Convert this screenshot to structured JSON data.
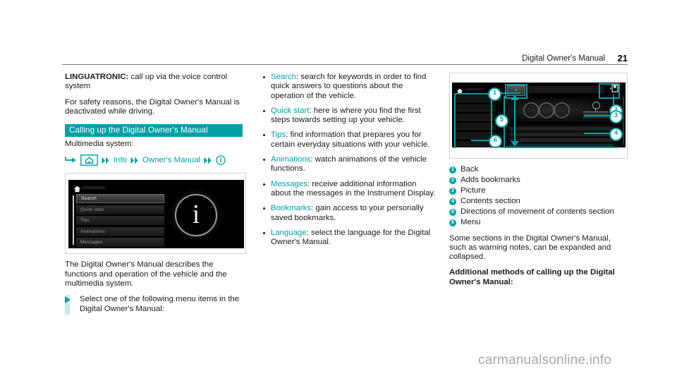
{
  "header": {
    "title": "Digital Owner's Manual",
    "page_number": "21"
  },
  "left_column": {
    "intro_bold": "LINGUATRONIC:",
    "intro_rest": " call up via the voice control system",
    "safety_note": "For safety reasons, the Digital Owner's Manual is deactivated while driving.",
    "section_heading": "Calling up the Digital Owner's Manual",
    "multimedia_label": "Multimedia system:",
    "nav_path": {
      "enter_icon": "corner-arrow-icon",
      "home_icon": "home-icon",
      "step1_label": "Info",
      "step2_label": "Owner's Manual",
      "end_icon": "info-circle-icon",
      "separator": "double-chevron-icon"
    },
    "screenshot": {
      "home_icon": "home-icon",
      "menu_items": [
        "Search",
        "Quick start",
        "Tips",
        "Animations",
        "Messages"
      ],
      "selected_item": "Search",
      "info_glyph": "i"
    },
    "describe_text": "The Digital Owner's Manual describes the functions and operation of the vehicle and the multimedia system.",
    "instruction": "Select one of the following menu items in the Digital Owner's Manual:"
  },
  "middle_column": {
    "menu_items": [
      {
        "keyword": "Search",
        "description": ": search for keywords in order to find quick answers to questions about the operation of the vehicle."
      },
      {
        "keyword": "Quick start",
        "description": ": here is where you find the first steps towards setting up your vehicle."
      },
      {
        "keyword": "Tips",
        "description": ": find information that prepares you for certain everyday situations with your vehicle."
      },
      {
        "keyword": "Animations",
        "description": ": watch animations of the vehicle functions."
      },
      {
        "keyword": "Messages",
        "description": ": receive additional information about the messages in the Instrument Display."
      },
      {
        "keyword": "Bookmarks",
        "description": ": gain access to your personally saved bookmarks."
      },
      {
        "keyword": "Language",
        "description": ": select the language for the Digital Owner's Manual."
      }
    ]
  },
  "right_column": {
    "diagram": {
      "home_icon": "home-icon",
      "back_icon": "back-chevron-icon",
      "bookmark_icon": "bookmark-icon",
      "callouts": [
        "1",
        "2",
        "3",
        "4",
        "5",
        "6"
      ]
    },
    "legend": [
      {
        "number": "1",
        "label": "Back"
      },
      {
        "number": "2",
        "label": "Adds bookmarks"
      },
      {
        "number": "3",
        "label": "Picture"
      },
      {
        "number": "4",
        "label": "Contents section"
      },
      {
        "number": "5",
        "label": "Directions of movement of contents section"
      },
      {
        "number": "6",
        "label": "Menu"
      }
    ],
    "expand_note": "Some sections in the Digital Owner's Manual, such as warning notes, can be expanded and collapsed.",
    "additional_heading": "Additional methods of calling up the Digital Owner's Manual:"
  },
  "watermark": "carmanualsonline.info",
  "colors": {
    "teal": "#00a0a6",
    "teal_light": "#c7eaea",
    "text": "#1a1a1a",
    "watermark_gray": "#a8a8a8"
  }
}
